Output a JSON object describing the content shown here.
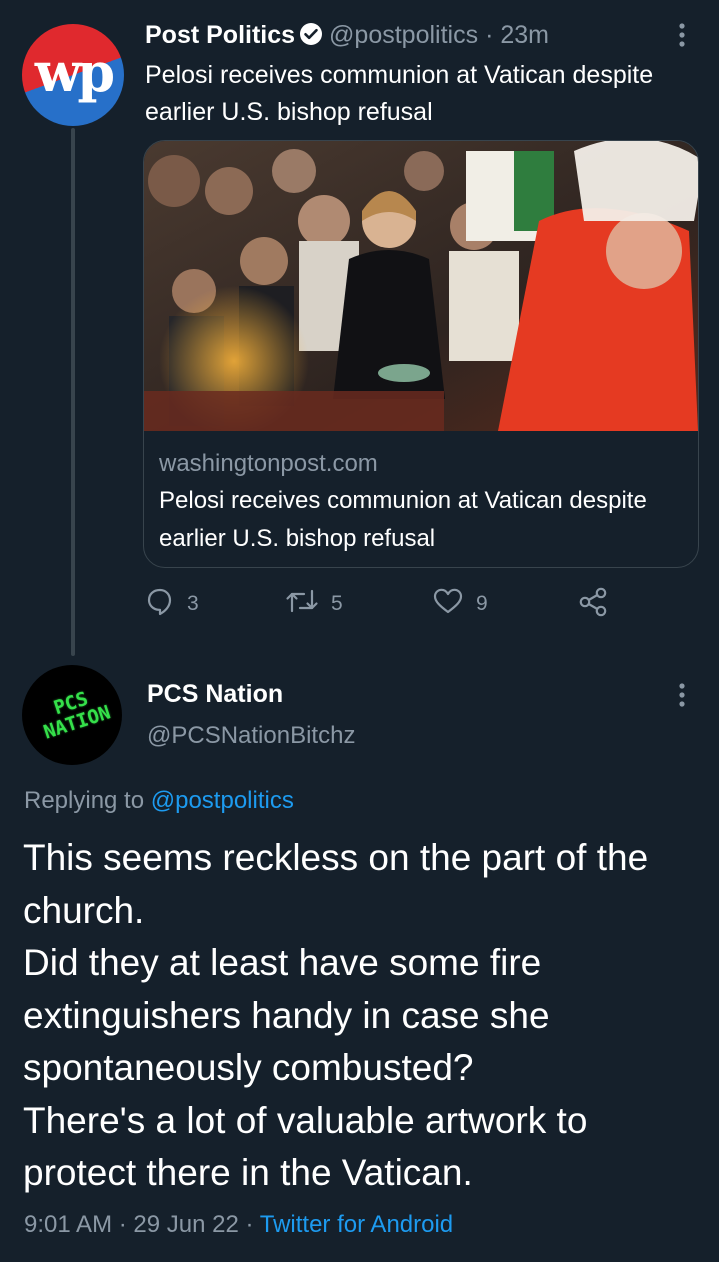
{
  "tweet": {
    "author_name": "Post Politics",
    "handle": "@postpolitics",
    "separator": "·",
    "time": "23m",
    "text": "Pelosi receives communion at Vatican despite earlier U.S. bishop refusal",
    "avatar_logo": "wp",
    "card": {
      "domain": "washingtonpost.com",
      "title": "Pelosi receives communion at Vatican despite earlier U.S. bishop refusal"
    },
    "actions": {
      "reply_count": "3",
      "retweet_count": "5",
      "like_count": "9"
    }
  },
  "reply": {
    "author_name": "PCS Nation",
    "handle": "@PCSNationBitchz",
    "avatar_text": "PCS NATION",
    "replying_prefix": "Replying to",
    "replying_to": "@postpolitics",
    "text": "This seems reckless on the part of the church.\nDid they at least have some fire extinguishers handy in case she spontaneously combusted?\nThere's a lot of valuable artwork to protect there in the Vatican.",
    "time": "9:01 AM",
    "date": "29 Jun 22",
    "separator": "·",
    "client": "Twitter for Android"
  },
  "icons": {
    "verified": "verified-badge-icon",
    "more": "more-vertical-icon",
    "reply": "reply-icon",
    "retweet": "retweet-icon",
    "like": "heart-icon",
    "share": "share-icon"
  },
  "colors": {
    "background": "#15202b",
    "text": "#ffffff",
    "muted": "#8b98a5",
    "link": "#1d9bf0",
    "divider": "#38444d"
  }
}
